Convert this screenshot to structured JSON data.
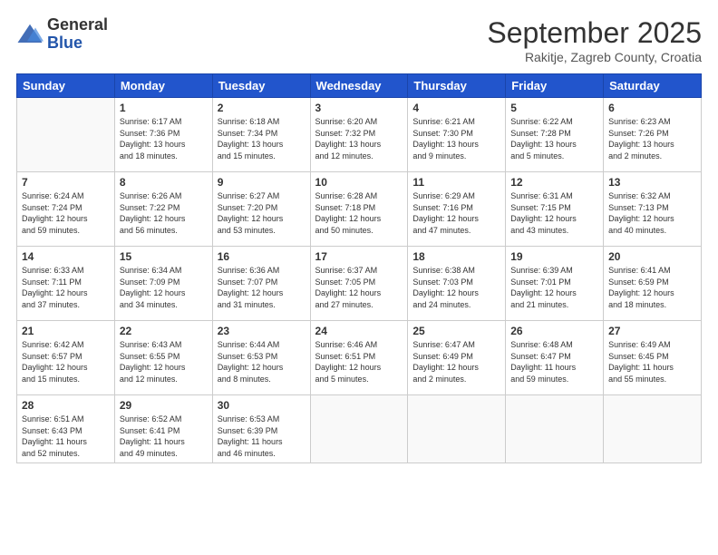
{
  "logo": {
    "general": "General",
    "blue": "Blue"
  },
  "header": {
    "month": "September 2025",
    "location": "Rakitje, Zagreb County, Croatia"
  },
  "weekdays": [
    "Sunday",
    "Monday",
    "Tuesday",
    "Wednesday",
    "Thursday",
    "Friday",
    "Saturday"
  ],
  "weeks": [
    [
      {
        "day": "",
        "info": ""
      },
      {
        "day": "1",
        "info": "Sunrise: 6:17 AM\nSunset: 7:36 PM\nDaylight: 13 hours\nand 18 minutes."
      },
      {
        "day": "2",
        "info": "Sunrise: 6:18 AM\nSunset: 7:34 PM\nDaylight: 13 hours\nand 15 minutes."
      },
      {
        "day": "3",
        "info": "Sunrise: 6:20 AM\nSunset: 7:32 PM\nDaylight: 13 hours\nand 12 minutes."
      },
      {
        "day": "4",
        "info": "Sunrise: 6:21 AM\nSunset: 7:30 PM\nDaylight: 13 hours\nand 9 minutes."
      },
      {
        "day": "5",
        "info": "Sunrise: 6:22 AM\nSunset: 7:28 PM\nDaylight: 13 hours\nand 5 minutes."
      },
      {
        "day": "6",
        "info": "Sunrise: 6:23 AM\nSunset: 7:26 PM\nDaylight: 13 hours\nand 2 minutes."
      }
    ],
    [
      {
        "day": "7",
        "info": "Sunrise: 6:24 AM\nSunset: 7:24 PM\nDaylight: 12 hours\nand 59 minutes."
      },
      {
        "day": "8",
        "info": "Sunrise: 6:26 AM\nSunset: 7:22 PM\nDaylight: 12 hours\nand 56 minutes."
      },
      {
        "day": "9",
        "info": "Sunrise: 6:27 AM\nSunset: 7:20 PM\nDaylight: 12 hours\nand 53 minutes."
      },
      {
        "day": "10",
        "info": "Sunrise: 6:28 AM\nSunset: 7:18 PM\nDaylight: 12 hours\nand 50 minutes."
      },
      {
        "day": "11",
        "info": "Sunrise: 6:29 AM\nSunset: 7:16 PM\nDaylight: 12 hours\nand 47 minutes."
      },
      {
        "day": "12",
        "info": "Sunrise: 6:31 AM\nSunset: 7:15 PM\nDaylight: 12 hours\nand 43 minutes."
      },
      {
        "day": "13",
        "info": "Sunrise: 6:32 AM\nSunset: 7:13 PM\nDaylight: 12 hours\nand 40 minutes."
      }
    ],
    [
      {
        "day": "14",
        "info": "Sunrise: 6:33 AM\nSunset: 7:11 PM\nDaylight: 12 hours\nand 37 minutes."
      },
      {
        "day": "15",
        "info": "Sunrise: 6:34 AM\nSunset: 7:09 PM\nDaylight: 12 hours\nand 34 minutes."
      },
      {
        "day": "16",
        "info": "Sunrise: 6:36 AM\nSunset: 7:07 PM\nDaylight: 12 hours\nand 31 minutes."
      },
      {
        "day": "17",
        "info": "Sunrise: 6:37 AM\nSunset: 7:05 PM\nDaylight: 12 hours\nand 27 minutes."
      },
      {
        "day": "18",
        "info": "Sunrise: 6:38 AM\nSunset: 7:03 PM\nDaylight: 12 hours\nand 24 minutes."
      },
      {
        "day": "19",
        "info": "Sunrise: 6:39 AM\nSunset: 7:01 PM\nDaylight: 12 hours\nand 21 minutes."
      },
      {
        "day": "20",
        "info": "Sunrise: 6:41 AM\nSunset: 6:59 PM\nDaylight: 12 hours\nand 18 minutes."
      }
    ],
    [
      {
        "day": "21",
        "info": "Sunrise: 6:42 AM\nSunset: 6:57 PM\nDaylight: 12 hours\nand 15 minutes."
      },
      {
        "day": "22",
        "info": "Sunrise: 6:43 AM\nSunset: 6:55 PM\nDaylight: 12 hours\nand 12 minutes."
      },
      {
        "day": "23",
        "info": "Sunrise: 6:44 AM\nSunset: 6:53 PM\nDaylight: 12 hours\nand 8 minutes."
      },
      {
        "day": "24",
        "info": "Sunrise: 6:46 AM\nSunset: 6:51 PM\nDaylight: 12 hours\nand 5 minutes."
      },
      {
        "day": "25",
        "info": "Sunrise: 6:47 AM\nSunset: 6:49 PM\nDaylight: 12 hours\nand 2 minutes."
      },
      {
        "day": "26",
        "info": "Sunrise: 6:48 AM\nSunset: 6:47 PM\nDaylight: 11 hours\nand 59 minutes."
      },
      {
        "day": "27",
        "info": "Sunrise: 6:49 AM\nSunset: 6:45 PM\nDaylight: 11 hours\nand 55 minutes."
      }
    ],
    [
      {
        "day": "28",
        "info": "Sunrise: 6:51 AM\nSunset: 6:43 PM\nDaylight: 11 hours\nand 52 minutes."
      },
      {
        "day": "29",
        "info": "Sunrise: 6:52 AM\nSunset: 6:41 PM\nDaylight: 11 hours\nand 49 minutes."
      },
      {
        "day": "30",
        "info": "Sunrise: 6:53 AM\nSunset: 6:39 PM\nDaylight: 11 hours\nand 46 minutes."
      },
      {
        "day": "",
        "info": ""
      },
      {
        "day": "",
        "info": ""
      },
      {
        "day": "",
        "info": ""
      },
      {
        "day": "",
        "info": ""
      }
    ]
  ]
}
